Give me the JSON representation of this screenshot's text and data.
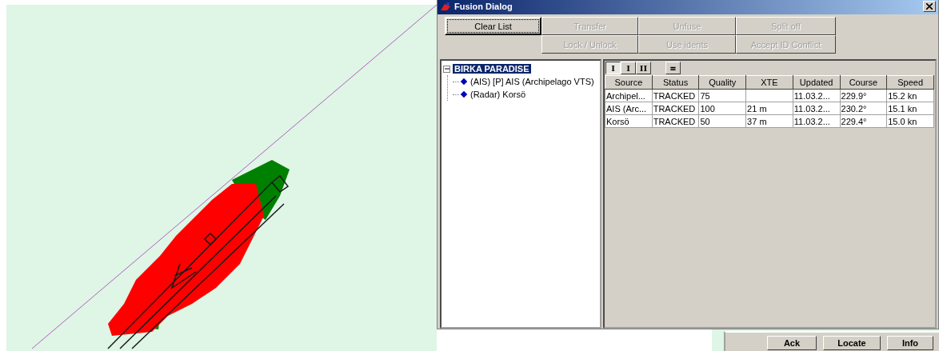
{
  "window": {
    "title": "Fusion Dialog"
  },
  "buttons": [
    {
      "label": "Clear List",
      "disabled": false,
      "focused": true
    },
    {
      "label": "Transfer",
      "disabled": true,
      "focused": false
    },
    {
      "label": "Unfuse",
      "disabled": true,
      "focused": false
    },
    {
      "label": "Split off",
      "disabled": true,
      "focused": false
    },
    {
      "label": "Lock / Unlock",
      "disabled": true,
      "focused": false
    },
    {
      "label": "Use idents",
      "disabled": true,
      "focused": false
    },
    {
      "label": "Accept ID Conflict",
      "disabled": true,
      "focused": false
    }
  ],
  "tree": {
    "label": "BIRKA PARADISE",
    "selected": true,
    "expanded": true,
    "children": [
      {
        "label": "(AIS)  [P] AIS (Archipelago VTS)",
        "selected": false
      },
      {
        "label": "(Radar) Korsö",
        "selected": false
      }
    ]
  },
  "view_buttons": [
    {
      "label": "I",
      "selected": true
    },
    {
      "label": "I",
      "selected": false
    },
    {
      "label": "II",
      "selected": false
    },
    {
      "label": "≡",
      "selected": false
    }
  ],
  "table": {
    "columns": [
      "Source",
      "Status",
      "Quality",
      "XTE",
      "Updated",
      "Course",
      "Speed"
    ],
    "rows": [
      [
        "Archipel...",
        "TRACKED",
        "75",
        null,
        "11.03.2...",
        "229.9°",
        "15.2 kn"
      ],
      [
        "AIS (Arc...",
        "TRACKED",
        "100",
        "21 m",
        "11.03.2...",
        "230.2°",
        "15.1 kn"
      ],
      [
        "Korsö",
        "TRACKED",
        "50",
        "37 m",
        "11.03.2...",
        "229.4°",
        "15.0 kn"
      ]
    ]
  },
  "bottom_buttons": [
    "Ack",
    "Locate",
    "Info"
  ]
}
